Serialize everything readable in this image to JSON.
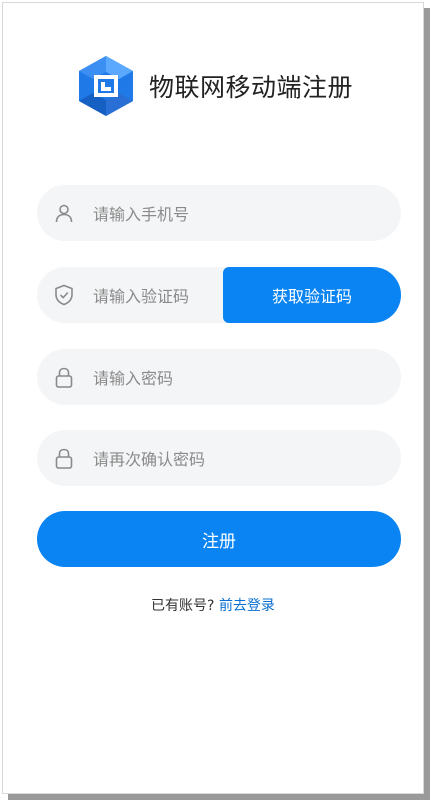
{
  "header": {
    "title": "物联网移动端注册",
    "logo_icon": "cube-logo-icon"
  },
  "form": {
    "phone": {
      "placeholder": "请输入手机号",
      "icon": "user-icon"
    },
    "code": {
      "placeholder": "请输入验证码",
      "icon": "shield-check-icon",
      "button_label": "获取验证码"
    },
    "password": {
      "placeholder": "请输入密码",
      "icon": "lock-icon"
    },
    "confirm_password": {
      "placeholder": "请再次确认密码",
      "icon": "lock-icon"
    },
    "submit_label": "注册"
  },
  "footer": {
    "prompt": "已有账号?",
    "login_link": "前去登录"
  },
  "colors": {
    "primary": "#0a84f2",
    "input_bg": "#f4f5f7",
    "link": "#0a6fd0"
  }
}
